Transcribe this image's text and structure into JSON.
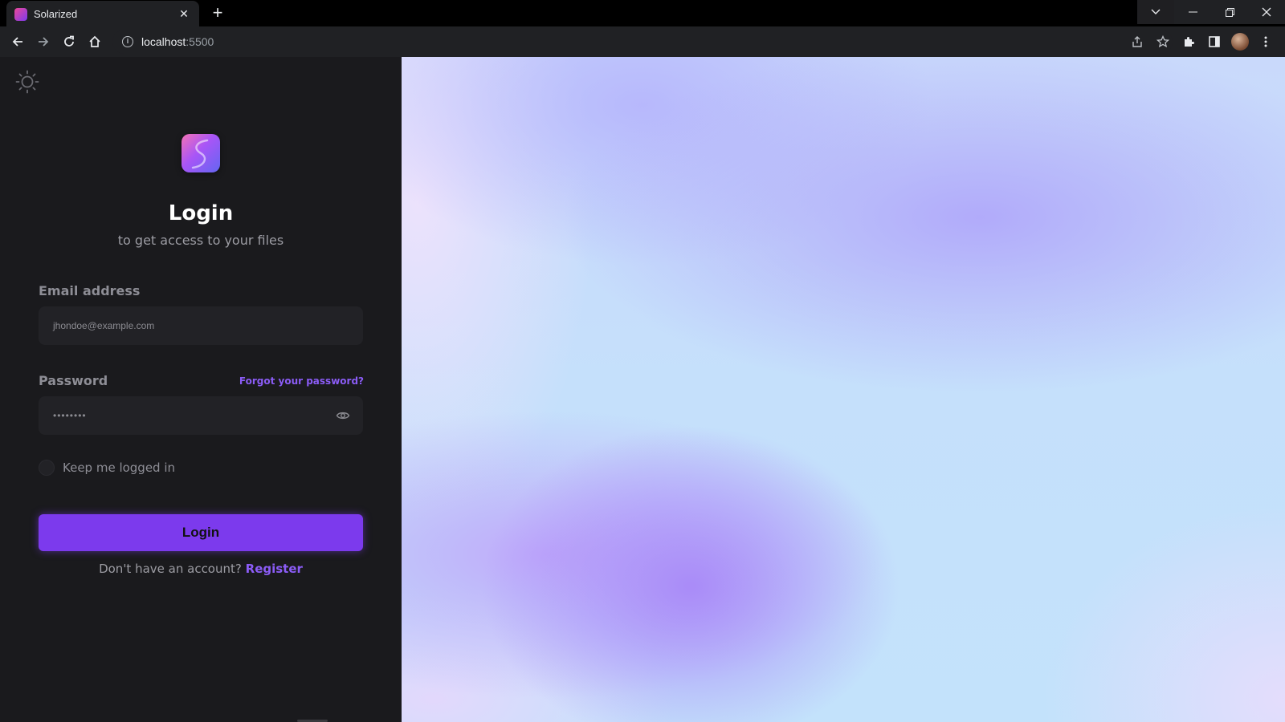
{
  "browser": {
    "tab_title": "Solarized",
    "tab_close": "✕",
    "new_tab": "+",
    "url_host": "localhost",
    "url_port": ":5500",
    "window_buttons": {
      "dropdown": "⌄",
      "minimize": "—",
      "restore": "❐",
      "close": "✕"
    }
  },
  "page": {
    "theme_toggle_icon": "sun-icon",
    "logo_icon": "solarized-logo",
    "title": "Login",
    "subtitle": "to get access to your files",
    "email": {
      "label": "Email address",
      "placeholder": "jhondoe@example.com"
    },
    "password": {
      "label": "Password",
      "masked_value": "••••••••",
      "forgot_link": "Forgot your password?"
    },
    "keep_logged_in": "Keep me logged in",
    "login_button": "Login",
    "register_prompt": "Don't have an account?",
    "register_link": "Register"
  },
  "colors": {
    "panel_bg": "#1a1a1d",
    "field_bg": "#222226",
    "accent": "#7c3aed",
    "link": "#8b5cf6"
  }
}
